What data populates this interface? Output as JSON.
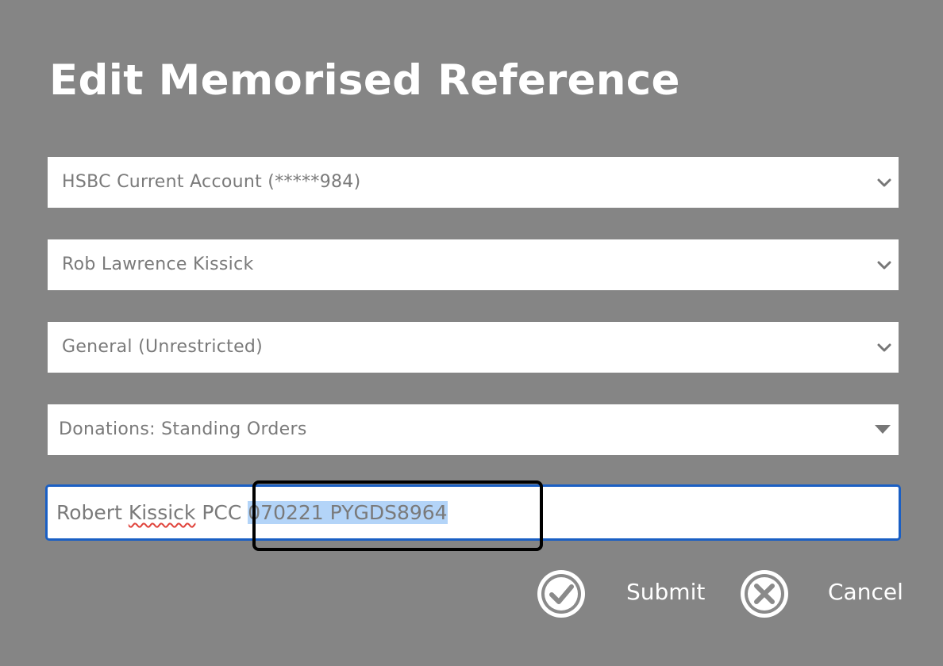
{
  "dialog": {
    "title": "Edit Memorised Reference"
  },
  "fields": {
    "account": {
      "value": "HSBC Current Account (*****984)",
      "icon": "chevron-down-icon"
    },
    "payee": {
      "value": "Rob Lawrence Kissick",
      "icon": "chevron-down-icon"
    },
    "fund": {
      "value": "General (Unrestricted)",
      "icon": "chevron-down-icon"
    },
    "category": {
      "value": "Donations: Standing Orders",
      "icon": "caret-down-icon"
    },
    "reference": {
      "prefix": "Robert ",
      "misspelled_word": "Kissick",
      "middle": " PCC ",
      "selected_text": "070221 PYGDS8964"
    }
  },
  "actions": {
    "submit_label": "Submit",
    "submit_icon": "check-circle-icon",
    "cancel_label": "Cancel",
    "cancel_icon": "x-circle-icon"
  },
  "colors": {
    "backdrop": "#858585",
    "focus_border": "#1a5fc4",
    "selection": "#b3d4f8",
    "spellcheck": "#e0443c"
  }
}
